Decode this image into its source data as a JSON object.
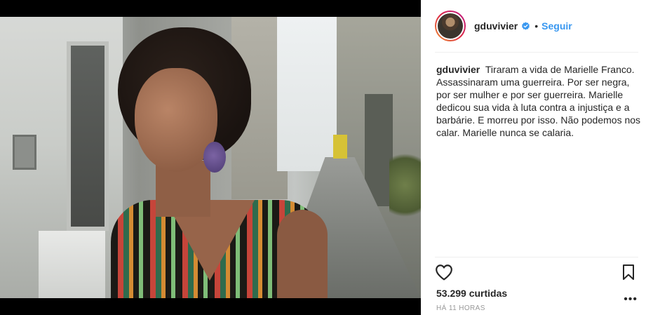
{
  "post": {
    "username": "gduvivier",
    "follow_label": "Seguir",
    "separator": "•",
    "caption_user": "gduvivier",
    "caption_text": "Tiraram a vida de Marielle Franco. Assassinaram uma guerreira. Por ser negra, por ser mulher e por ser guerreira. Marielle dedicou sua vida à luta contra a injustiça e a barbárie. E morreu por isso. Não podemos nos calar. Marielle nunca se calaria.",
    "likes": "53.299 curtidas",
    "time": "HÁ 11 HORAS",
    "more": "•••"
  },
  "icons": {
    "verified": "verified-badge-icon",
    "like": "heart-icon",
    "save": "bookmark-icon",
    "options": "more-options-icon"
  },
  "colors": {
    "follow": "#3897f0",
    "verified": "#3897f0",
    "text": "#262626",
    "muted": "#999999"
  }
}
